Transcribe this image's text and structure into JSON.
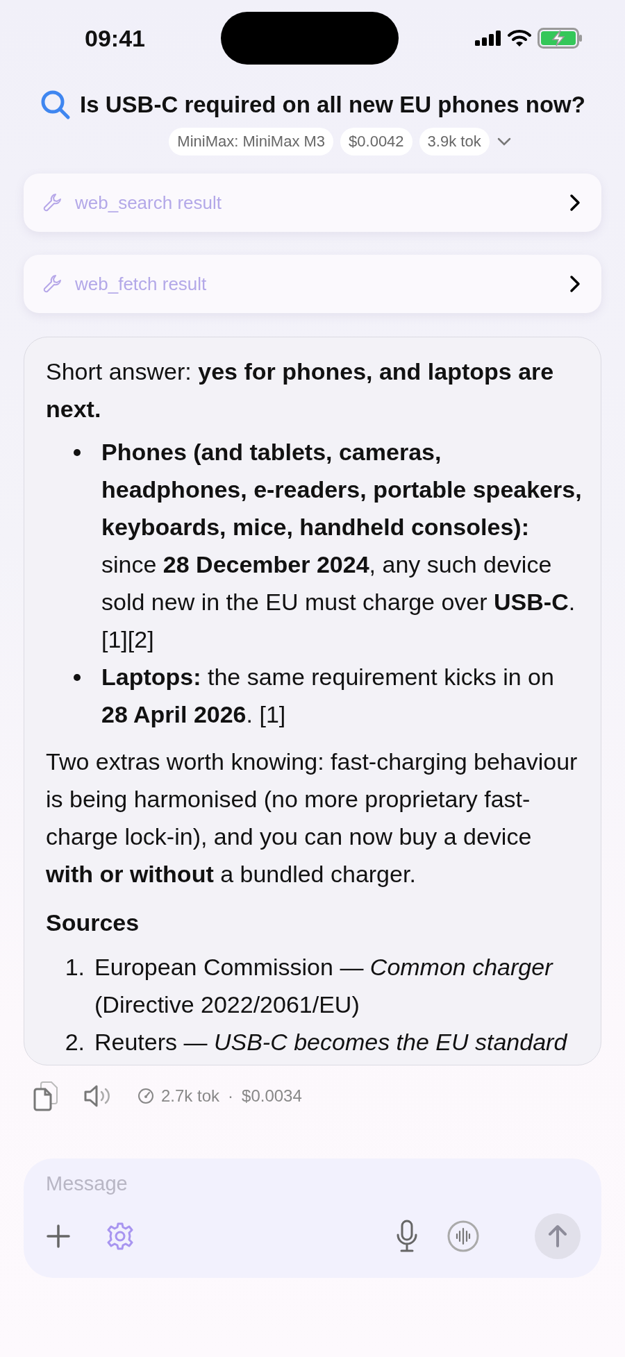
{
  "status_bar": {
    "time": "09:41"
  },
  "header": {
    "title": "Is USB-C required on all new EU phones now?",
    "chips": [
      "MiniMax: MiniMax M3",
      "$0.0042",
      "3.9k tok"
    ]
  },
  "tool_results": [
    {
      "label": "web_search result"
    },
    {
      "label": "web_fetch result"
    }
  ],
  "message": {
    "blocks": [
      {
        "kind": "paragraph",
        "text": "Short answer: **yes for phones, and laptops are next.**"
      },
      {
        "kind": "bullets",
        "items": [
          "**Phones (and tablets, cameras, headphones, e-readers, portable speakers, keyboards, mice, handheld consoles):** since **28 December 2024**, any such device sold new in the EU must charge over **USB-C**. [1][2]",
          "**Laptops:** the same requirement kicks in on **28 April 2026**. [1]"
        ]
      },
      {
        "kind": "paragraph",
        "text": "Two extras worth knowing: fast-charging behaviour is being harmonised (no more proprietary fast-charge lock-in), and you can now buy a device **with or without** a bundled charger."
      },
      {
        "kind": "heading",
        "text": "Sources"
      },
      {
        "kind": "numbered",
        "items": [
          {
            "marker": "1.",
            "text": "European Commission — *Common charger* (Directive 2022/2061/EU)"
          },
          {
            "marker": "2.",
            "text": "Reuters — *USB-C becomes the EU standard*"
          }
        ]
      }
    ]
  },
  "message_footer": {
    "tokens": "2.7k tok",
    "separator": "·",
    "cost": "$0.0034"
  },
  "composer": {
    "placeholder": "Message"
  }
}
